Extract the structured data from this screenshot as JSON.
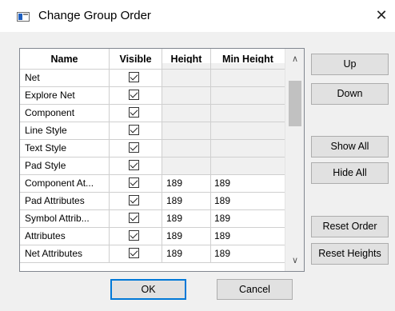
{
  "window": {
    "title": "Change Group Order",
    "close_glyph": "✕"
  },
  "table": {
    "columns": [
      "Name",
      "Visible",
      "Height",
      "Min Height"
    ],
    "rows": [
      {
        "name": "Net",
        "visible": true,
        "height": "",
        "min_height": ""
      },
      {
        "name": "Explore Net",
        "visible": true,
        "height": "",
        "min_height": ""
      },
      {
        "name": "Component",
        "visible": true,
        "height": "",
        "min_height": ""
      },
      {
        "name": "Line Style",
        "visible": true,
        "height": "",
        "min_height": ""
      },
      {
        "name": "Text Style",
        "visible": true,
        "height": "",
        "min_height": ""
      },
      {
        "name": "Pad Style",
        "visible": true,
        "height": "",
        "min_height": ""
      },
      {
        "name": "Component At...",
        "visible": true,
        "height": "189",
        "min_height": "189"
      },
      {
        "name": "Pad Attributes",
        "visible": true,
        "height": "189",
        "min_height": "189"
      },
      {
        "name": "Symbol Attrib...",
        "visible": true,
        "height": "189",
        "min_height": "189"
      },
      {
        "name": "Attributes",
        "visible": true,
        "height": "189",
        "min_height": "189"
      },
      {
        "name": "Net Attributes",
        "visible": true,
        "height": "189",
        "min_height": "189"
      }
    ]
  },
  "scrollbar": {
    "up_glyph": "∧",
    "down_glyph": "∨"
  },
  "side_buttons": {
    "up": "Up",
    "down": "Down",
    "show_all": "Show All",
    "hide_all": "Hide All",
    "reset_order": "Reset Order",
    "reset_heights": "Reset Heights"
  },
  "footer_buttons": {
    "ok": "OK",
    "cancel": "Cancel"
  },
  "colors": {
    "accent": "#0078d7",
    "button_face": "#e1e1e1",
    "shaded_cell": "#f0f0f0"
  }
}
